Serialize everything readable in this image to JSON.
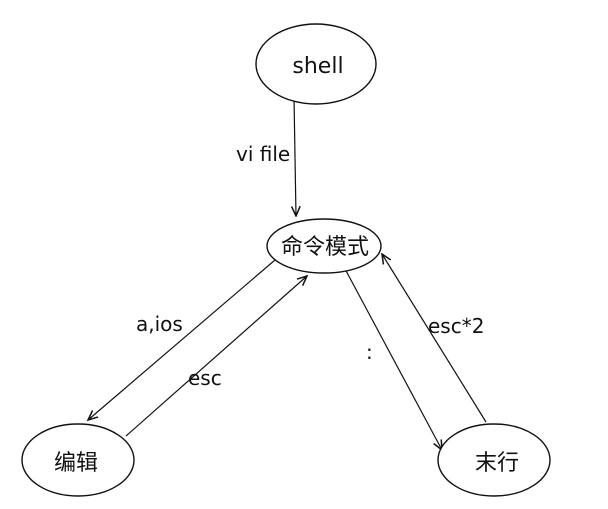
{
  "diagram": {
    "nodes": {
      "shell": "shell",
      "command_mode": "命令模式",
      "edit": "编辑",
      "last_line": "末行"
    },
    "edges": {
      "shell_to_command": "vi file",
      "command_to_edit": "a,ios",
      "edit_to_command": "esc",
      "command_to_last_line": ":",
      "last_line_to_command": "esc*2"
    }
  }
}
